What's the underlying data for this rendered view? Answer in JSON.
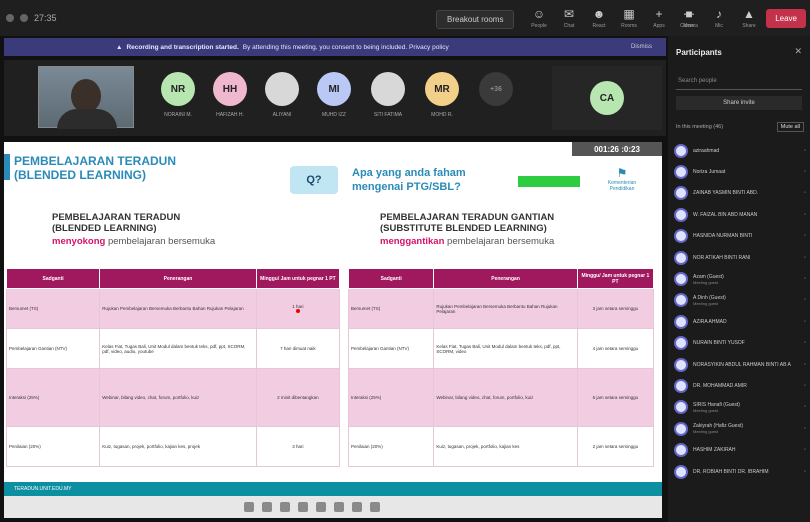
{
  "topbar": {
    "timer": "27:35",
    "meeting_title": "Breakout rooms",
    "icons": [
      {
        "name": "people-icon",
        "label": "People",
        "glyph": "☺"
      },
      {
        "name": "chat-icon",
        "label": "Chat",
        "glyph": "✉"
      },
      {
        "name": "reactions-icon",
        "label": "React",
        "glyph": "☻"
      },
      {
        "name": "rooms-icon",
        "label": "Rooms",
        "glyph": "▦"
      },
      {
        "name": "apps-icon",
        "label": "Apps",
        "glyph": "+"
      },
      {
        "name": "more-icon",
        "label": "More",
        "glyph": "⋯"
      }
    ],
    "right_icons": [
      {
        "name": "camera-icon",
        "label": "Camera",
        "glyph": "■"
      },
      {
        "name": "mic-icon",
        "label": "Mic",
        "glyph": "♪"
      },
      {
        "name": "share-icon",
        "label": "Share",
        "glyph": "▲"
      }
    ],
    "leave_label": "Leave"
  },
  "banner": {
    "icon": "▲",
    "bold": "Recording and transcription started.",
    "text": "By attending this meeting, you consent to being included. Privacy policy",
    "dismiss": "Dismiss"
  },
  "participants_strip": [
    {
      "initials": "NR",
      "name": "NORAINI M.",
      "color": "#b8e6b0"
    },
    {
      "initials": "HH",
      "name": "HAFIZAH H.",
      "color": "#f0b8cf"
    },
    {
      "initials": "",
      "name": "ALIYANI",
      "color": "#d8d8d8"
    },
    {
      "initials": "MI",
      "name": "MUHD IZZ",
      "color": "#b9c8f5"
    },
    {
      "initials": "",
      "name": "SITI FATIMA",
      "color": "#d8d8d8"
    },
    {
      "initials": "MR",
      "name": "MOHD R.",
      "color": "#f3d089"
    },
    {
      "initials": "+36",
      "name": "",
      "color": "#3a3a3a"
    }
  ],
  "ca_tile": {
    "initials": "CA",
    "color": "#b8e6b0"
  },
  "slide": {
    "title_line1": "PEMBELAJARAN TERADUN",
    "title_line2": "(BLENDED LEARNING)",
    "q_label": "Q?",
    "question_line1": "Apa yang anda faham",
    "question_line2": "mengenai PTG/SBL?",
    "counter": "001:26  :0:23",
    "logo_text": "Kementerian Pendidikan",
    "left_sub1": "PEMBELAJARAN TERADUN",
    "left_sub2": "(BLENDED LEARNING)",
    "left_hl": "menyokong",
    "left_rest": " pembelajaran bersemuka",
    "right_sub1": "PEMBELAJARAN TERADUN GANTIAN",
    "right_sub2": "(SUBSTITUTE BLENDED LEARNING)",
    "right_hl": "menggantikan",
    "right_rest": " pembelajaran bersemuka",
    "table_headers": [
      "Sadganti",
      "Penerangan",
      "Minggu/ Jam untuk pegnar 1 PT"
    ],
    "left_rows": [
      {
        "c1": "Bersumet (TS)",
        "c2": "Rujukan Pembelajaran Bersemuka Berbantu Bahan Rujukan Pelajaran",
        "c3": "1 hari",
        "dot": true,
        "pink": true
      },
      {
        "c1": "Pembelajaran Gantian (NTV)",
        "c2": "Kelas Fiat, Tugas Bali, Unit Modul dalam bentuk teks, pdf, ppt, SCORM, pdf, video, audio, youtube",
        "c3": "7 hari dimuat naik",
        "dot": false,
        "pink": false
      },
      {
        "c1": "Interaksi (25%)",
        "c2": "Webinar, bilang video, chat, forum, portfolio, kuiz",
        "c3": "2 minit dibentangkan",
        "dot": false,
        "pink": true
      },
      {
        "c1": "Penilaian (20%)",
        "c2": "Kuiz, tugasan, projek, portfolio, kajian kes, projek",
        "c3": "3 hari",
        "dot": false,
        "pink": false
      }
    ],
    "right_rows": [
      {
        "c1": "Bersumet (TS)",
        "c2": "Rujukan Pembelajaran Bersemuka Berbantu Bahan Rujukan Pelajaran",
        "c3": "3 jam setara seminggu",
        "pink": true
      },
      {
        "c1": "Pembelajaran Gantian (NTV)",
        "c2": "Kelas Fiat, Tugas Bali, Unit Modul dalam bentuk teks, pdf, ppt, SCORM, video",
        "c3": "4 jam setara seminggu",
        "pink": false
      },
      {
        "c1": "Interaksi (25%)",
        "c2": "Webinar, bilang video, chat, forum, portfolio, kuiz",
        "c3": "6 jam setara seminggu",
        "pink": true
      },
      {
        "c1": "Penilaian (20%)",
        "c2": "Kuiz, tugasan, projek, portfolio, kajian kes",
        "c3": "2 jam setara seminggu",
        "pink": false
      }
    ],
    "bottom_strip": "TERADUN.UNIT.EDU.MY"
  },
  "panel": {
    "title": "Participants",
    "close": "✕",
    "search_placeholder": "Search people",
    "share_label": "Share invite",
    "section": "In this meeting (46)",
    "mute_all": "Mute all",
    "people": [
      {
        "name": "aziraahmad",
        "sub": ""
      },
      {
        "name": "Noriza Jumaat",
        "sub": ""
      },
      {
        "name": "ZAINAB YASMIN BINTI ABD.",
        "sub": ""
      },
      {
        "name": "W. FAIZAL BIN ABD MANAN",
        "sub": ""
      },
      {
        "name": "HASNIDA NURMAN BINTI",
        "sub": ""
      },
      {
        "name": "NOR ATIKAH BINTI RANI",
        "sub": ""
      },
      {
        "name": "Azam (Guest)",
        "sub": "Meeting guest"
      },
      {
        "name": "A Dinh (Guest)",
        "sub": "Meeting guest"
      },
      {
        "name": "AZIRA AHMAD",
        "sub": ""
      },
      {
        "name": "NURAIN BINTI YUSOF",
        "sub": ""
      },
      {
        "name": "NORASYIKIN ABDUL RAHMAN BINTI AB A",
        "sub": ""
      },
      {
        "name": "DR. MOHAMMAD AMIR",
        "sub": ""
      },
      {
        "name": "SIRIS Hanafi (Guest)",
        "sub": "Meeting guest"
      },
      {
        "name": "Zakiyrah (Hafiz Guest)",
        "sub": "Meeting guest"
      },
      {
        "name": "HASHIM ZAKIRAH",
        "sub": ""
      },
      {
        "name": "DR. ROBIAH BINTI DR. IBRAHIM",
        "sub": ""
      }
    ]
  }
}
